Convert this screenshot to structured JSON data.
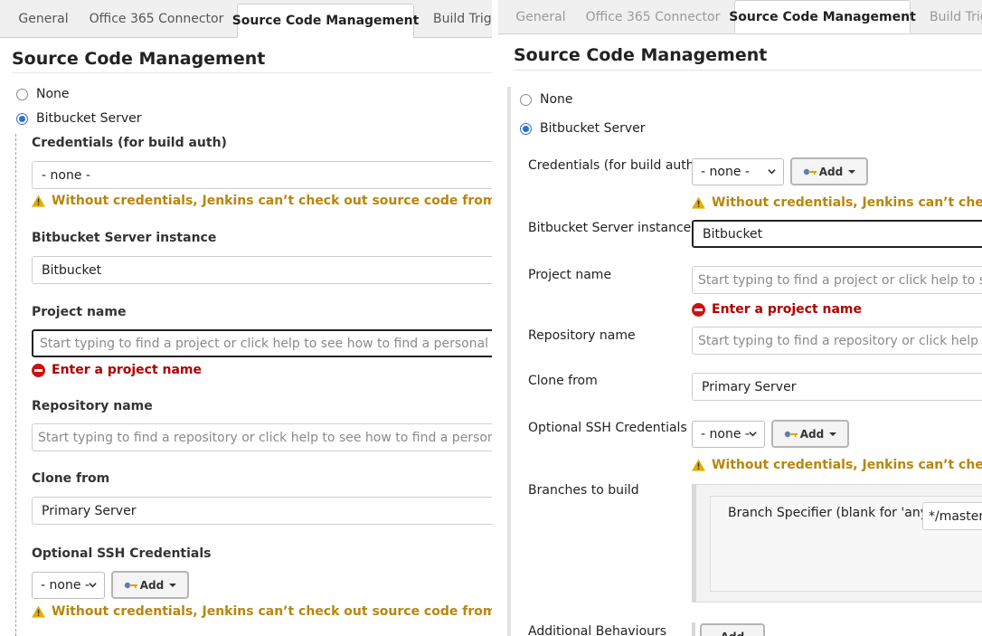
{
  "left": {
    "tabs": [
      "General",
      "Office 365 Connector",
      "Source Code Management",
      "Build Trigg"
    ],
    "title": "Source Code Management",
    "radio_none": "None",
    "radio_bitbucket": "Bitbucket Server",
    "credentials_label": "Credentials (for build auth)",
    "credentials_value": "- none -",
    "warning": "Without credentials, Jenkins can’t check out source code from non-public",
    "instance_label": "Bitbucket Server instance",
    "instance_value": "Bitbucket",
    "project_label": "Project name",
    "project_placeholder": "Start typing to find a project or click help to see how to find a personal project",
    "project_error": "Enter a project name",
    "repo_label": "Repository name",
    "repo_placeholder": "Start typing to find a repository or click help to see how to find a personal repos",
    "clone_label": "Clone from",
    "clone_value": "Primary Server",
    "ssh_label": "Optional SSH Credentials",
    "ssh_value": "- none -",
    "add_label": "Add",
    "ssh_warning": "Without credentials, Jenkins can’t check out source code from non-public"
  },
  "right": {
    "tabs": [
      "General",
      "Office 365 Connector",
      "Source Code Management",
      "Build Trigg"
    ],
    "title": "Source Code Management",
    "radio_none": "None",
    "radio_bitbucket": "Bitbucket Server",
    "credentials_label": "Credentials (for build auth)",
    "credentials_value": "- none -",
    "add_label": "Add",
    "warning": "Without credentials, Jenkins can’t check out s",
    "instance_label": "Bitbucket Server instance",
    "instance_value": "Bitbucket",
    "project_label": "Project name",
    "project_placeholder": "Start typing to find a project or click help to see ho",
    "project_error": "Enter a project name",
    "repo_label": "Repository name",
    "repo_placeholder": "Start typing to find a repository or click help to se",
    "clone_label": "Clone from",
    "clone_value": "Primary Server",
    "ssh_label": "Optional SSH Credentials",
    "ssh_value": "- none -",
    "ssh_warning": "Without credentials, Jenkins can’t check out s",
    "branches_label": "Branches to build",
    "branch_spec_label": "Branch Specifier (blank for 'any')",
    "branch_spec_value": "*/master",
    "behaviours_label": "Additional Behaviours",
    "behaviours_add": "Add"
  },
  "colors": {
    "accent": "#2d6fd2",
    "warning": "#b8860b",
    "error": "#b00000"
  },
  "icons": [
    "warning-icon",
    "error-icon",
    "key-icon",
    "chevron-down-icon",
    "caret-down-icon"
  ]
}
